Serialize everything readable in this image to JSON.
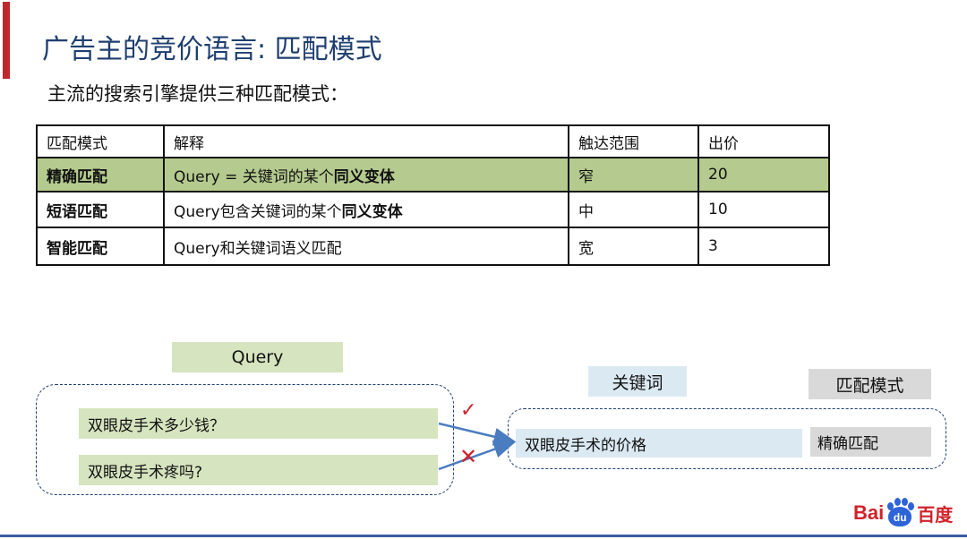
{
  "slide": {
    "title": "广告主的竞价语言: 匹配模式",
    "subtitle": "主流的搜索引擎提供三种匹配模式："
  },
  "table": {
    "headers": [
      "匹配模式",
      "解释",
      "触达范围",
      "出价"
    ],
    "rows": [
      {
        "mode": "精确匹配",
        "explain_prefix": "Query = 关键词的某个",
        "explain_bold": "同义变体",
        "reach": "窄",
        "bid": "20",
        "highlight": true
      },
      {
        "mode": "短语匹配",
        "explain_prefix": "Query包含关键词的某个",
        "explain_bold": "同义变体",
        "reach": "中",
        "bid": "10",
        "highlight": false
      },
      {
        "mode": "智能匹配",
        "explain_prefix": "Query和关键词语义匹配",
        "explain_bold": "",
        "reach": "宽",
        "bid": "3",
        "highlight": false
      }
    ]
  },
  "diagram": {
    "query_header": "Query",
    "keyword_header": "关键词",
    "mode_header": "匹配模式",
    "query_items": [
      "双眼皮手术多少钱？",
      "双眼皮手术疼吗?"
    ],
    "keyword": "双眼皮手术的价格",
    "mode": "精确匹配",
    "match_symbol": "✓",
    "mismatch_symbol": "✕"
  },
  "logo": {
    "left_text": "Bai",
    "paw_text": "du",
    "right_text": "百度"
  },
  "colors": {
    "title": "#1f3f70",
    "accent_red": "#c0272d",
    "highlight_green": "#b4ca8e",
    "light_green": "#d6e4bf",
    "light_blue": "#dbe9f2",
    "light_gray": "#d9d9d9",
    "arrow_blue": "#4a7cc0"
  }
}
